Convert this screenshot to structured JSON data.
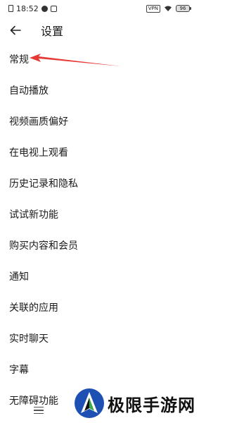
{
  "status_bar": {
    "time": "18:52",
    "vpn": "VPN",
    "battery": "96"
  },
  "header": {
    "title": "设置"
  },
  "settings": {
    "items": [
      {
        "label": "常规"
      },
      {
        "label": "自动播放"
      },
      {
        "label": "视频画质偏好"
      },
      {
        "label": "在电视上观看"
      },
      {
        "label": "历史记录和隐私"
      },
      {
        "label": "试试新功能"
      },
      {
        "label": "购买内容和会员"
      },
      {
        "label": "通知"
      },
      {
        "label": "关联的应用"
      },
      {
        "label": "实时聊天"
      },
      {
        "label": "字幕"
      },
      {
        "label": "无障碍功能"
      }
    ]
  },
  "watermark": {
    "text": "极限手游网"
  },
  "colors": {
    "arrow": "#e53935",
    "logo_blue": "#1e4fb3",
    "logo_green": "#3aa84a"
  }
}
